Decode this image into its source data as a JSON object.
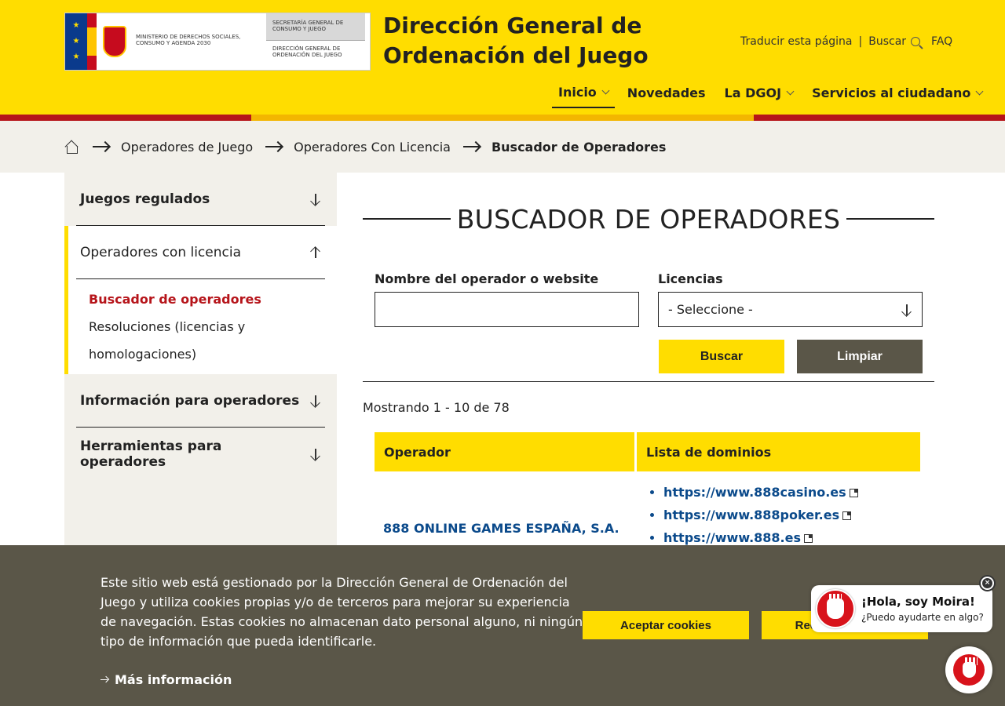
{
  "header": {
    "logo": {
      "ministry": "MINISTERIO DE DERECHOS SOCIALES, CONSUMO Y AGENDA 2030",
      "secretaria": "SECRETARÍA GENERAL DE CONSUMO Y JUEGO",
      "direccion": "DIRECCIÓN GENERAL DE ORDENACIÓN DEL JUEGO"
    },
    "site_title": "Dirección General de Ordenación del Juego",
    "top_links": {
      "translate": "Traducir esta página",
      "separator": "|",
      "search": "Buscar",
      "faq": "FAQ"
    },
    "nav": [
      {
        "label": "Inicio"
      },
      {
        "label": "Novedades"
      },
      {
        "label": "La DGOJ"
      },
      {
        "label": "Servicios al ciudadano"
      }
    ]
  },
  "breadcrumb": {
    "items": [
      "Operadores de Juego",
      "Operadores Con Licencia",
      "Buscador de Operadores"
    ]
  },
  "sidebar": {
    "sections": [
      {
        "label": "Juegos regulados"
      },
      {
        "label": "Operadores con licencia",
        "subitems": [
          "Buscador de operadores",
          "Resoluciones (licencias y homologaciones)"
        ]
      },
      {
        "label": "Información para operadores"
      },
      {
        "label": "Herramientas para operadores"
      }
    ]
  },
  "main": {
    "title": "BUSCADOR DE OPERADORES",
    "form": {
      "name_label": "Nombre del operador o website",
      "name_value": "",
      "licenses_label": "Licencias",
      "licenses_selected": "- Seleccione -",
      "search_button": "Buscar",
      "clear_button": "Limpiar"
    },
    "results_count": "Mostrando 1 - 10 de 78",
    "table": {
      "headers": [
        "Operador",
        "Lista de dominios"
      ],
      "rows": [
        {
          "operator": "888 ONLINE GAMES ESPAÑA, S.A.",
          "domains": [
            "https://www.888casino.es",
            "https://www.888poker.es",
            "https://www.888.es"
          ]
        }
      ]
    }
  },
  "cookie": {
    "text": "Este sitio web está gestionado por la Dirección General de Ordenación del Juego y utiliza cookies propias y/o de terceros para mejorar su experiencia de navegación. Estas cookies no almacenan dato personal alguno, ni ningún tipo de información que pueda identificarle.",
    "more": "Más información",
    "accept": "Aceptar cookies",
    "reject": "Rechazar cookies"
  },
  "chat": {
    "greeting": "¡Hola, soy Moira!",
    "prompt": "¿Puedo ayudarte en algo?",
    "close": "×"
  },
  "colors": {
    "brand_yellow": "#ffdd00",
    "brand_red": "#b6141a",
    "link_blue": "#0b4a8b",
    "banner_gray": "#5a5648"
  }
}
